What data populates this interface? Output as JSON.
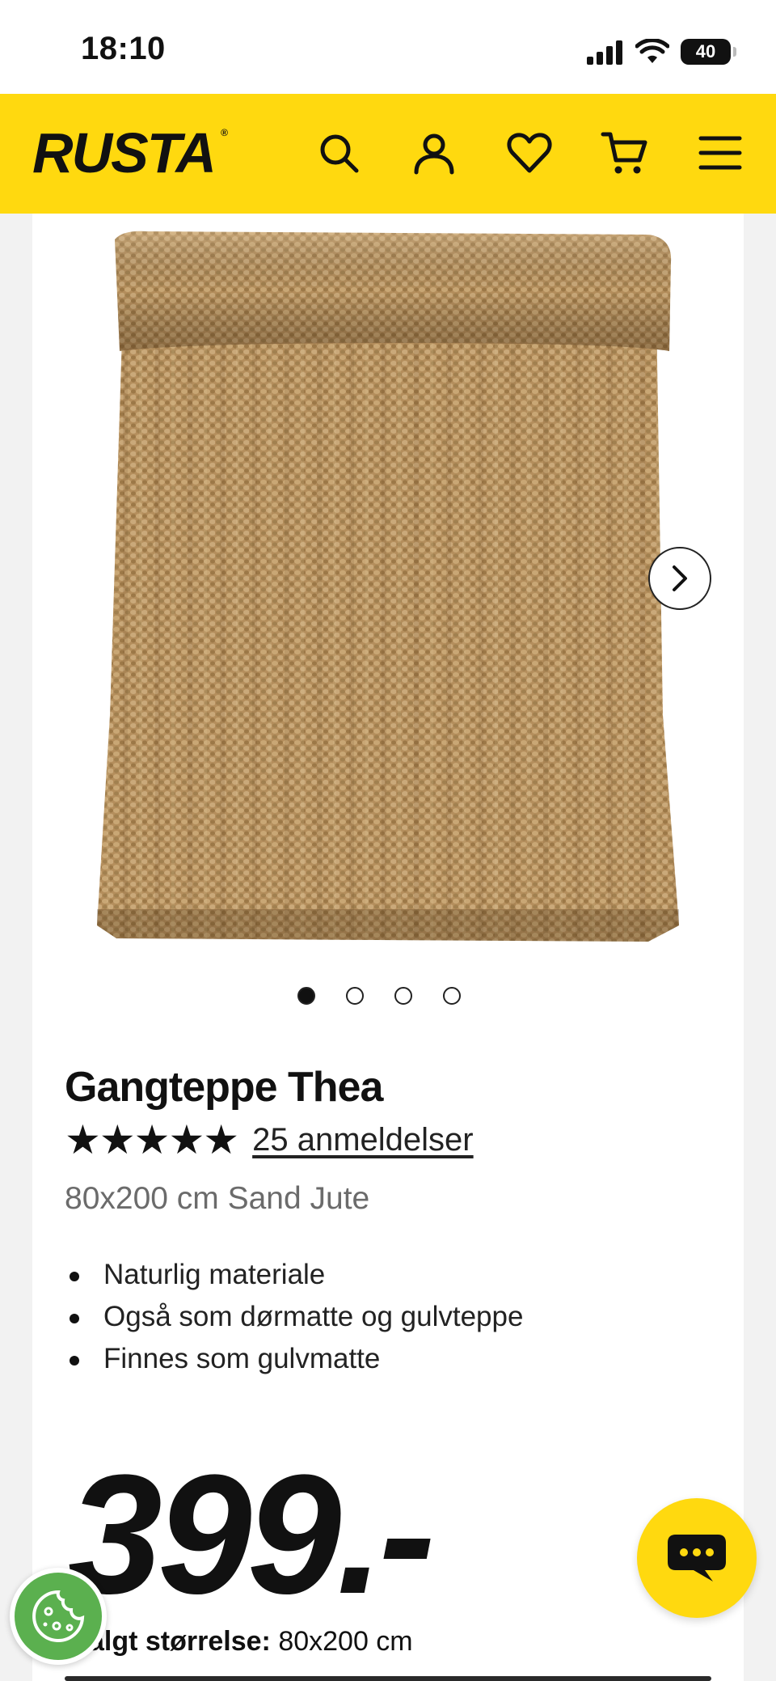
{
  "status_bar": {
    "time": "18:10",
    "battery": "40"
  },
  "header": {
    "logo": "RUSTA",
    "icons": [
      "search-icon",
      "account-icon",
      "wishlist-heart-icon",
      "cart-icon",
      "menu-icon"
    ],
    "brand_color": "#ffd90f"
  },
  "product": {
    "title": "Gangteppe Thea",
    "rating_stars": "★★★★★",
    "reviews_label": "25 anmeldelser",
    "variant": "80x200 cm Sand Jute",
    "features": [
      "Naturlig materiale",
      "Også som dørmatte og gulvteppe",
      "Finnes som gulvmatte"
    ],
    "price": "399.-",
    "selected_size_label": "algt størrelse:",
    "selected_size_value": "80x200 cm",
    "gallery": {
      "slide_count": 4,
      "active_index": 0
    }
  },
  "floating": {
    "chat_icon": "chat-bubble-icon",
    "cookie_icon": "cookie-icon"
  }
}
